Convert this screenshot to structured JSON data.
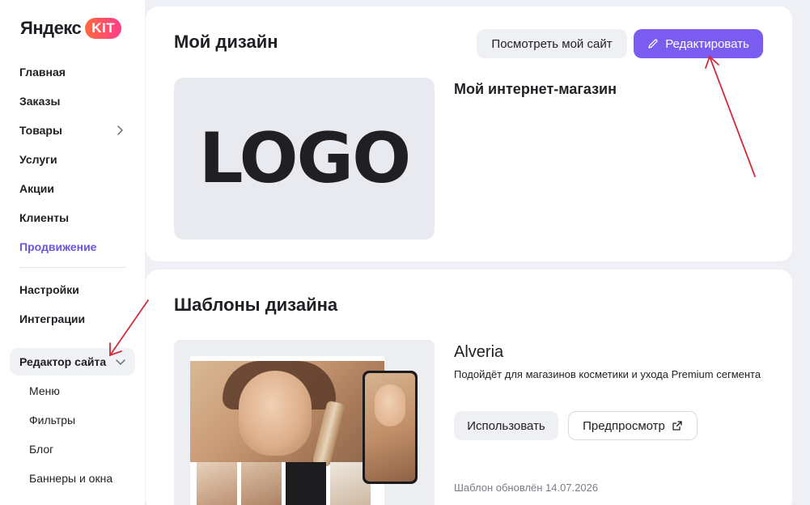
{
  "brand": {
    "name": "Яндекс",
    "badge": "KIT"
  },
  "sidebar": {
    "items": [
      {
        "label": "Главная"
      },
      {
        "label": "Заказы"
      },
      {
        "label": "Товары"
      },
      {
        "label": "Услуги"
      },
      {
        "label": "Акции"
      },
      {
        "label": "Клиенты"
      },
      {
        "label": "Продвижение"
      },
      {
        "label": "Настройки"
      },
      {
        "label": "Интеграции"
      }
    ],
    "editor": {
      "label": "Редактор сайта",
      "sub_items": [
        {
          "label": "Меню"
        },
        {
          "label": "Фильтры"
        },
        {
          "label": "Блог"
        },
        {
          "label": "Баннеры и окна"
        }
      ]
    }
  },
  "my_design": {
    "title": "Мой дизайн",
    "view_site_label": "Посмотреть мой сайт",
    "edit_label": "Редактировать",
    "logo_text": "LOGO",
    "shop_name": "Мой интернет-магазин"
  },
  "templates": {
    "title": "Шаблоны дизайна",
    "items": [
      {
        "name": "Alveria",
        "description": "Подойдёт для магазинов косметики и ухода Premium сегмента",
        "use_label": "Использовать",
        "preview_label": "Предпросмотр",
        "updated": "Шаблон обновлён 14.07.2026"
      }
    ]
  },
  "colors": {
    "accent": "#7a5cf0",
    "active_nav": "#6a55e0",
    "kit_gradient_start": "#ff6a3d",
    "kit_gradient_end": "#ff3d8b",
    "annotation_arrow": "#d22b3a"
  }
}
